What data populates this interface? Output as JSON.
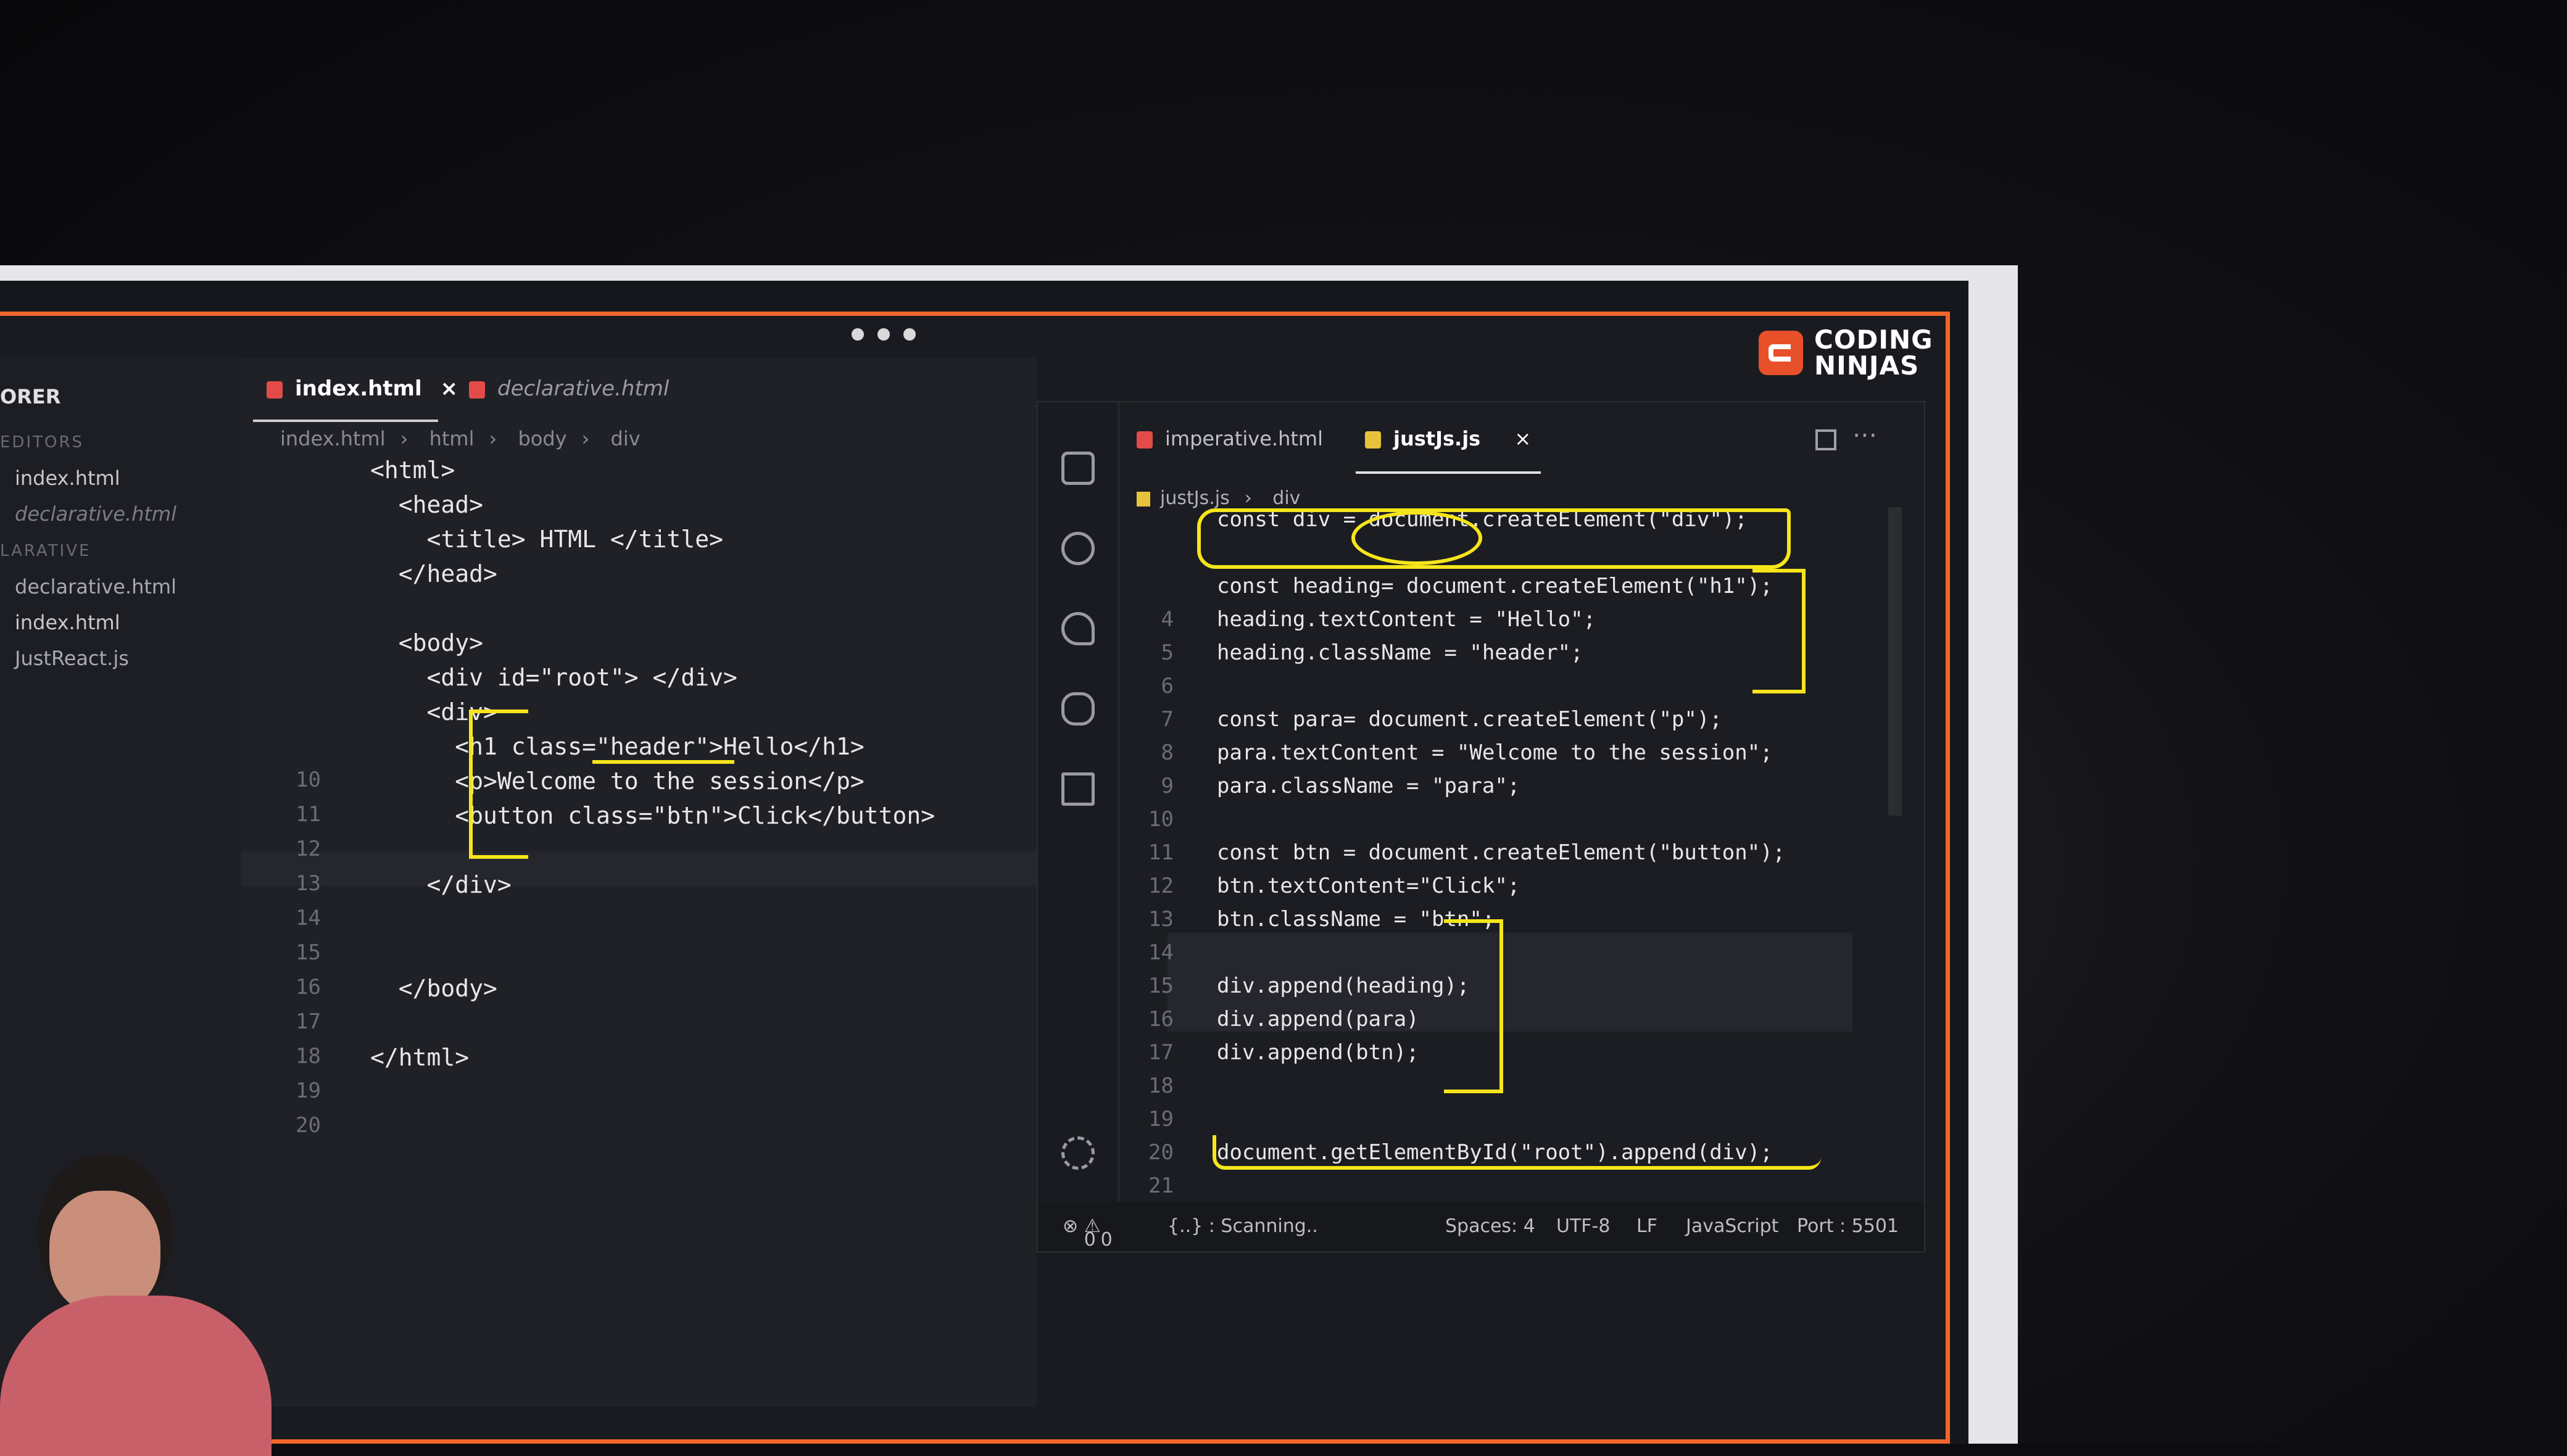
{
  "brand": {
    "line1": "CODING",
    "line2": "NINJAS"
  },
  "explorer": {
    "title": "ORER",
    "section_open": "EDITORS",
    "open_files": [
      "index.html",
      "declarative.html"
    ],
    "section_folder": "LARATIVE",
    "files": [
      "declarative.html",
      "index.html",
      "JustReact.js"
    ]
  },
  "left_editor": {
    "tabs": [
      {
        "label": "index.html",
        "active": true,
        "close": "×"
      },
      {
        "label": "declarative.html",
        "active": false
      }
    ],
    "breadcrumb": [
      "index.html",
      "html",
      "body",
      "div"
    ],
    "line_numbers": [
      "",
      "",
      "",
      "",
      "",
      "",
      "",
      "",
      "",
      "10",
      "11",
      "12",
      "13",
      "14",
      "15",
      "16",
      "17",
      "18",
      "19",
      "20"
    ],
    "code": [
      "<html>",
      "  <head>",
      "    <title> HTML </title>",
      "  </head>",
      "",
      "  <body>",
      "    <div id=\"root\"> </div>",
      "    <div>",
      "      <h1 class=\"header\">Hello</h1>",
      "      <p>Welcome to the session</p>",
      "      <button class=\"btn\">Click</button>",
      "",
      "    </div>",
      "",
      "",
      "  </body>",
      "",
      "</html>"
    ]
  },
  "right_editor": {
    "tabs": [
      {
        "label": "imperative.html",
        "active": false
      },
      {
        "label": "justJs.js",
        "active": true,
        "close": "×"
      }
    ],
    "breadcrumb": [
      "justJs.js",
      "div"
    ],
    "line_numbers": [
      "",
      "",
      "",
      "4",
      "5",
      "6",
      "7",
      "8",
      "9",
      "10",
      "11",
      "12",
      "13",
      "14",
      "15",
      "16",
      "17",
      "18",
      "19",
      "20",
      "21"
    ],
    "code": [
      "const div = document.createElement(\"div\");",
      "",
      "const heading= document.createElement(\"h1\");",
      "heading.textContent = \"Hello\";",
      "heading.className = \"header\";",
      "",
      "const para= document.createElement(\"p\");",
      "para.textContent = \"Welcome to the session\";",
      "para.className = \"para\";",
      "",
      "const btn = document.createElement(\"button\");",
      "btn.textContent=\"Click\";",
      "btn.className = \"btn\";",
      "",
      "div.append(heading);",
      "div.append(para)",
      "div.append(btn);",
      "",
      "",
      "document.getElementById(\"root\").append(div);",
      ""
    ]
  },
  "status_bar": {
    "errors": "0",
    "warnings": "0",
    "scanning": "{..} : Scanning..",
    "spaces": "Spaces: 4",
    "encoding": "UTF-8",
    "eol": "LF",
    "language": "JavaScript",
    "port": "Port : 5501"
  },
  "colors": {
    "accent": "#f2662b",
    "annotation": "#f6e51b",
    "background": "#1c1d22"
  }
}
